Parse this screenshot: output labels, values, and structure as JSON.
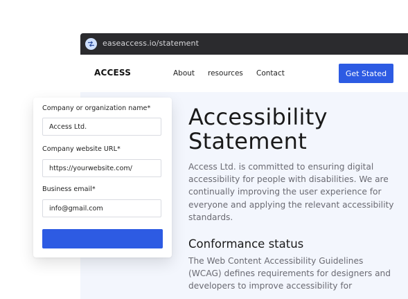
{
  "browser": {
    "url": "easeaccess.io/statement",
    "url_icon": "site-settings-icon"
  },
  "nav": {
    "logo": "ACCESS",
    "links": [
      "About",
      "resources",
      "Contact"
    ],
    "cta": "Get Stated"
  },
  "page": {
    "title_line1": "Accessibility",
    "title_line2": "Statement",
    "intro": "Access Ltd. is committed to ensuring digital accessibility for people with disabilities. We are continually improving the user experience for everyone and applying the relevant accessibility standards.",
    "section_title": "Conformance status",
    "section_text": "The Web Content Accessibility Guidelines (WCAG) defines requirements for designers and developers to improve accessibility for"
  },
  "form": {
    "company_label": "Company or organization name*",
    "company_value": "Access Ltd.",
    "website_label": "Company website URL*",
    "website_value": "https://yourwebsite.com/",
    "email_label": "Business email*",
    "email_value": "info@gmail.com"
  },
  "colors": {
    "accent": "#2d5be3",
    "urlbar": "#2b2b2e",
    "page_bg": "#f3f6fd"
  }
}
